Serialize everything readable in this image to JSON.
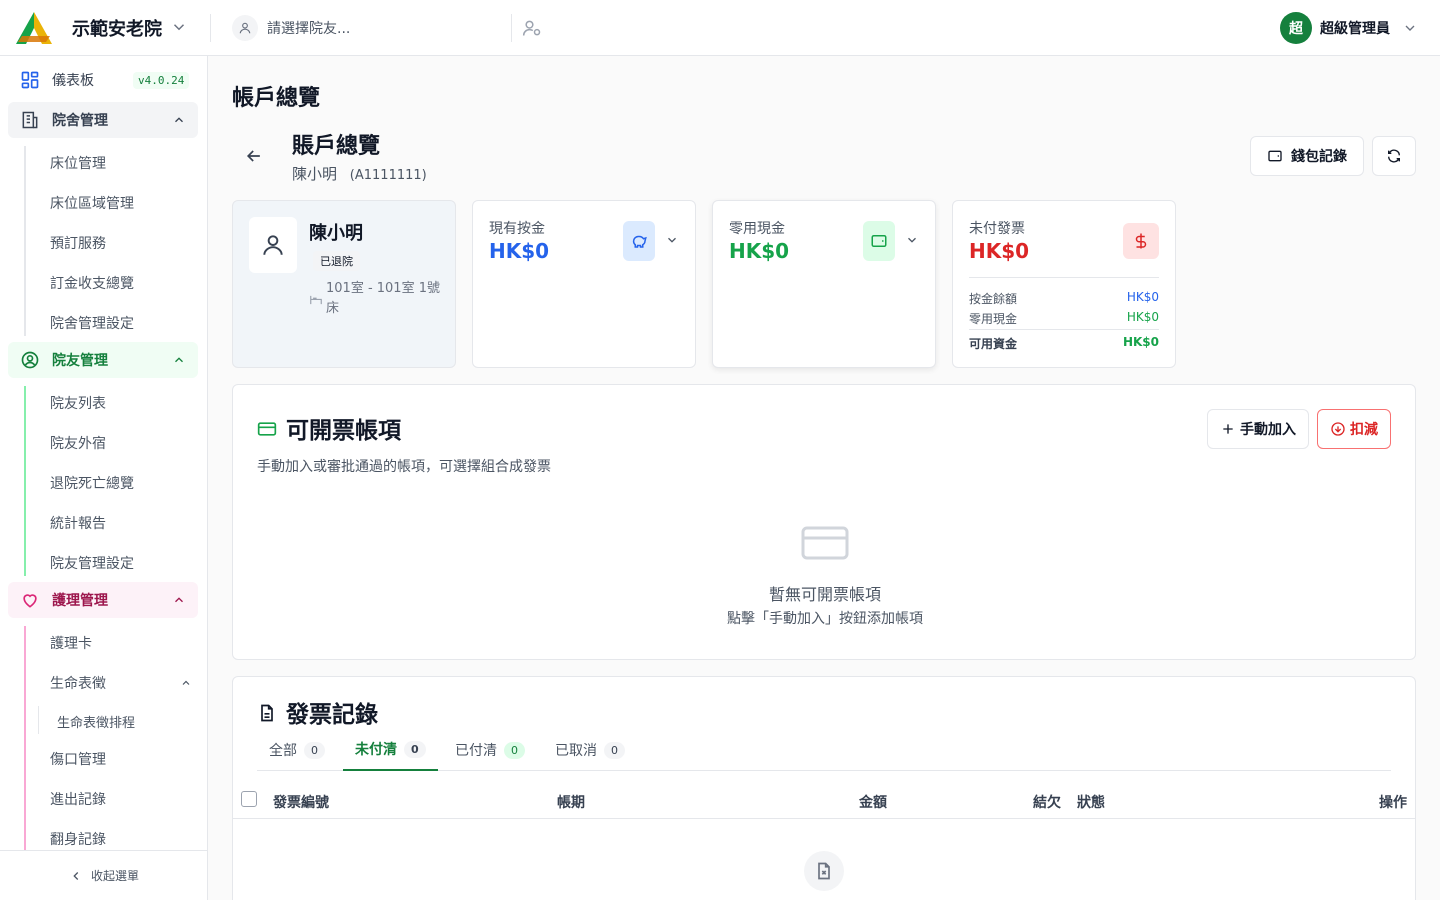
{
  "header": {
    "org_name": "示範安老院",
    "resident_placeholder": "請選擇院友...",
    "user_avatar": "超",
    "user_name": "超級管理員",
    "accent": "#15803d"
  },
  "sidebar": {
    "dashboard": "儀表板",
    "version": "v4.0.24",
    "groups": [
      {
        "label": "院舍管理",
        "items": [
          "床位管理",
          "床位區域管理",
          "預訂服務",
          "訂金收支總覽",
          "院舍管理設定"
        ]
      },
      {
        "label": "院友管理",
        "items": [
          "院友列表",
          "院友外宿",
          "退院死亡總覽",
          "統計報告",
          "院友管理設定"
        ]
      },
      {
        "label": "護理管理",
        "items": [
          "護理卡",
          "生命表徵",
          "生命表徵排程",
          "傷口管理",
          "進出記錄",
          "翻身記錄"
        ]
      }
    ],
    "collapse": "收起選單"
  },
  "main": {
    "page_title": "帳戶總覽",
    "account_title": "賬戶總覽",
    "resident_name": "陳小明",
    "resident_id": "(A1111111)",
    "wallet_button": "錢包記錄",
    "profile": {
      "name": "陳小明",
      "status": "已退院",
      "bed": "101室 - 101室 1號床"
    },
    "deposit": {
      "label": "現有按金",
      "value": "HK$0"
    },
    "petty": {
      "label": "零用現金",
      "value": "HK$0"
    },
    "unpaid": {
      "label": "未付發票",
      "value": "HK$0",
      "rows": [
        {
          "k": "按金餘額",
          "v": "HK$0"
        },
        {
          "k": "零用現金",
          "v": "HK$0"
        },
        {
          "k": "可用資金",
          "v": "HK$0"
        }
      ]
    },
    "billable": {
      "title": "可開票帳項",
      "desc": "手動加入或審批通過的帳項，可選擇組合成發票",
      "add_button": "手動加入",
      "deduct_button": "扣減",
      "empty_title": "暫無可開票帳項",
      "empty_hint": "點擊「手動加入」按鈕添加帳項"
    },
    "invoices": {
      "title": "發票記錄",
      "tabs": [
        {
          "label": "全部",
          "count": "0"
        },
        {
          "label": "未付清",
          "count": "0"
        },
        {
          "label": "已付清",
          "count": "0"
        },
        {
          "label": "已取消",
          "count": "0"
        }
      ],
      "columns": [
        "發票編號",
        "帳期",
        "金額",
        "結欠",
        "狀態",
        "操作"
      ]
    }
  }
}
